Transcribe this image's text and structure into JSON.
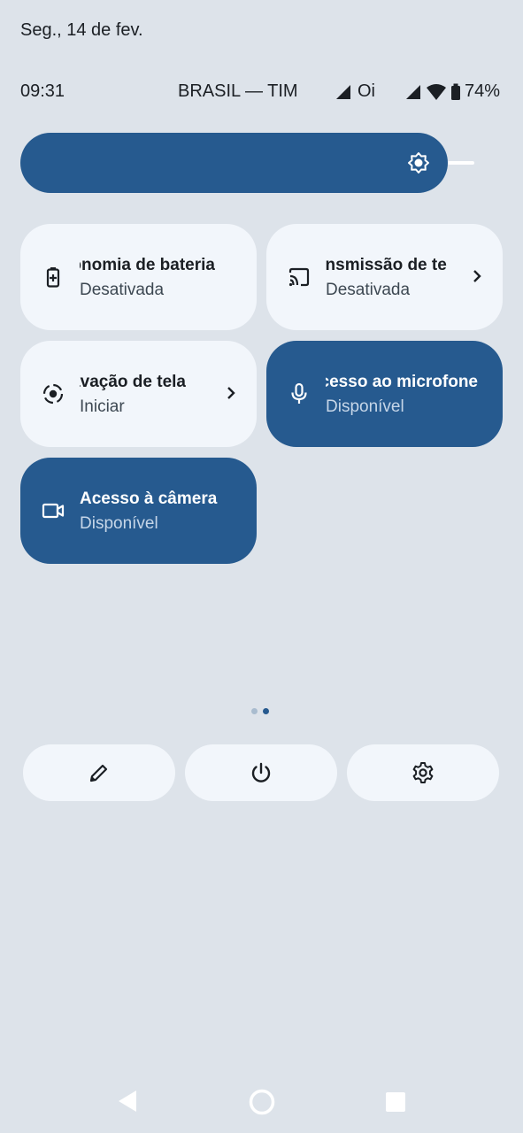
{
  "header": {
    "date": "Seg., 14 de fev."
  },
  "statusbar": {
    "time": "09:31",
    "carrier": "BRASIL — TIM",
    "carrier2": "Oi",
    "battery": "74%"
  },
  "brightness": {
    "icon": "brightness-icon",
    "level": 0.9
  },
  "tiles": [
    {
      "label": "Economia de bateria",
      "state": "Desativada",
      "icon": "battery-saver-icon",
      "active": false
    },
    {
      "label": "Transmissão de tela",
      "state": "Desativada",
      "icon": "cast-icon",
      "active": false
    },
    {
      "label": "Gravação de tela",
      "state": "Iniciar",
      "icon": "screen-record-icon",
      "active": false
    },
    {
      "label": "Acesso ao microfone",
      "state": "Disponível",
      "icon": "microphone-icon",
      "active": true
    },
    {
      "label": "Acesso à câmera",
      "state": "Disponível",
      "icon": "camera-icon",
      "active": true
    }
  ],
  "pager": {
    "pages": 2,
    "current": 2
  },
  "bottom_buttons": [
    {
      "icon": "edit-pencil-icon"
    },
    {
      "icon": "power-icon"
    },
    {
      "icon": "settings-gear-icon"
    }
  ],
  "navbar": [
    "back-icon",
    "home-icon",
    "recents-icon"
  ],
  "colors": {
    "background": "#dde3ea",
    "accent": "#265a8f",
    "tile_inactive": "#f2f6fb"
  }
}
